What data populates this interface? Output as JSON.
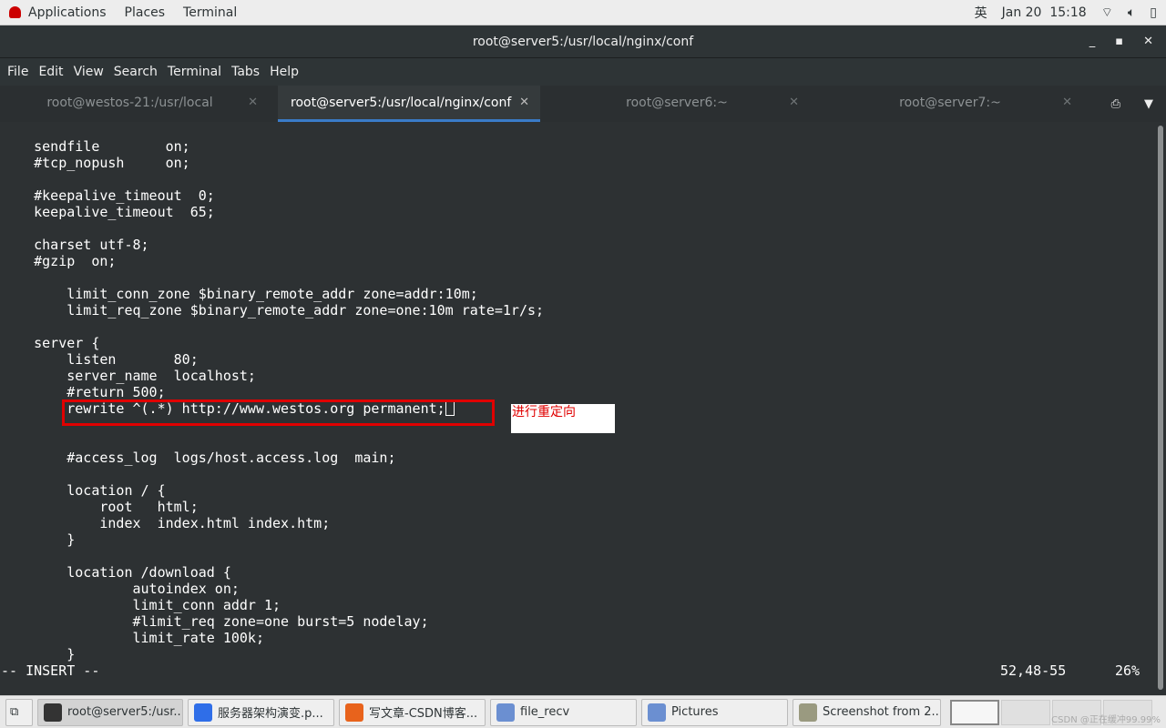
{
  "topbar": {
    "applications": "Applications",
    "places": "Places",
    "terminal": "Terminal",
    "input_method": "英",
    "datetime": "Jan 20  15:18"
  },
  "window": {
    "title": "root@server5:/usr/local/nginx/conf"
  },
  "menu": [
    "File",
    "Edit",
    "View",
    "Search",
    "Terminal",
    "Tabs",
    "Help"
  ],
  "tabs": [
    {
      "label": "root@westos-21:/usr/local",
      "active": false
    },
    {
      "label": "root@server5:/usr/local/nginx/conf",
      "active": true
    },
    {
      "label": "root@server6:~",
      "active": false
    },
    {
      "label": "root@server7:~",
      "active": false
    }
  ],
  "terminal": {
    "lines": [
      "    sendfile        on;",
      "    #tcp_nopush     on;",
      "",
      "    #keepalive_timeout  0;",
      "    keepalive_timeout  65;",
      "",
      "    charset utf-8;",
      "    #gzip  on;",
      "",
      "        limit_conn_zone $binary_remote_addr zone=addr:10m;",
      "        limit_req_zone $binary_remote_addr zone=one:10m rate=1r/s;",
      "",
      "    server {",
      "        listen       80;",
      "        server_name  localhost;",
      "        #return 500;",
      "        rewrite ^(.*) http://www.westos.org permanent;",
      "",
      "",
      "        #access_log  logs/host.access.log  main;",
      "",
      "        location / {",
      "            root   html;",
      "            index  index.html index.htm;",
      "        }",
      "",
      "        location /download {",
      "                autoindex on;",
      "                limit_conn addr 1;",
      "                #limit_req zone=one burst=5 nodelay;",
      "                limit_rate 100k;",
      "        }"
    ],
    "mode": "-- INSERT --",
    "position": "52,48-55",
    "percent": "26%"
  },
  "annotation": "进行重定向",
  "taskbar": [
    {
      "label": "root@server5:/usr...",
      "color": "#333333"
    },
    {
      "label": "服务器架构演变.p...",
      "color": "#2f6ee8"
    },
    {
      "label": "写文章-CSDN博客...",
      "color": "#e8631c"
    },
    {
      "label": "file_recv",
      "color": "#6b8fd1"
    },
    {
      "label": "Pictures",
      "color": "#6b8fd1"
    },
    {
      "label": "Screenshot from 2...",
      "color": "#9a9a80"
    }
  ],
  "watermark": "CSDN @正在缓冲99.99%"
}
